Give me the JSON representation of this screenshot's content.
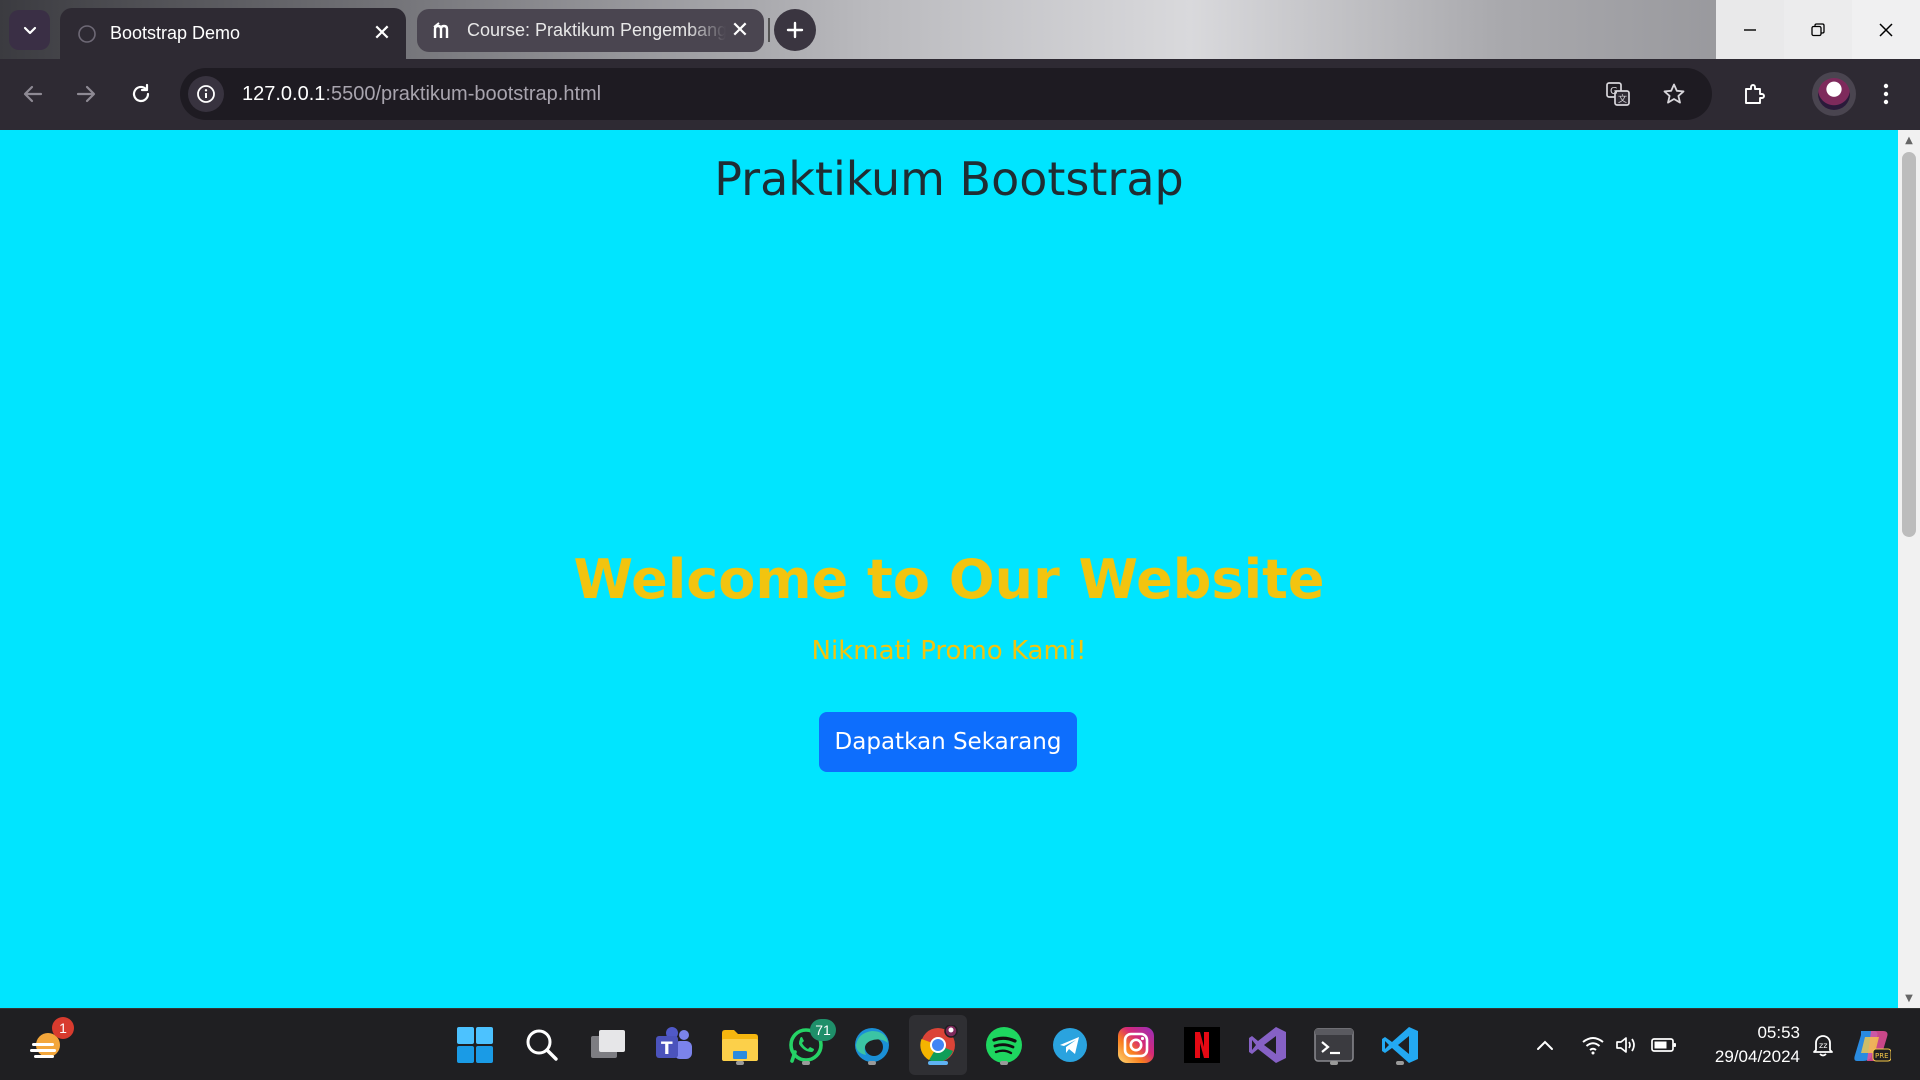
{
  "browser": {
    "tabs": [
      {
        "title": "Bootstrap Demo",
        "active": true
      },
      {
        "title": "Course: Praktikum Pengembangan",
        "active": false
      }
    ],
    "url_host": "127.0.0.1",
    "url_rest": ":5500/praktikum-bootstrap.html"
  },
  "page": {
    "background": "#00e5ff",
    "title": "Praktikum Bootstrap",
    "hero_heading": "Welcome to Our Website",
    "hero_subtitle": "Nikmati Promo Kami!",
    "hero_button": "Dapatkan Sekarang",
    "accent_color": "#f2c40f",
    "button_color": "#0d6efd"
  },
  "taskbar": {
    "widget_badge": "1",
    "whatsapp_badge": "71",
    "apps": [
      "start",
      "search",
      "task-view",
      "teams",
      "file-explorer",
      "whatsapp",
      "edge",
      "chrome",
      "spotify",
      "telegram",
      "instagram",
      "netflix",
      "visual-studio",
      "terminal",
      "vscode"
    ],
    "time": "05:53",
    "date": "29/04/2024"
  }
}
